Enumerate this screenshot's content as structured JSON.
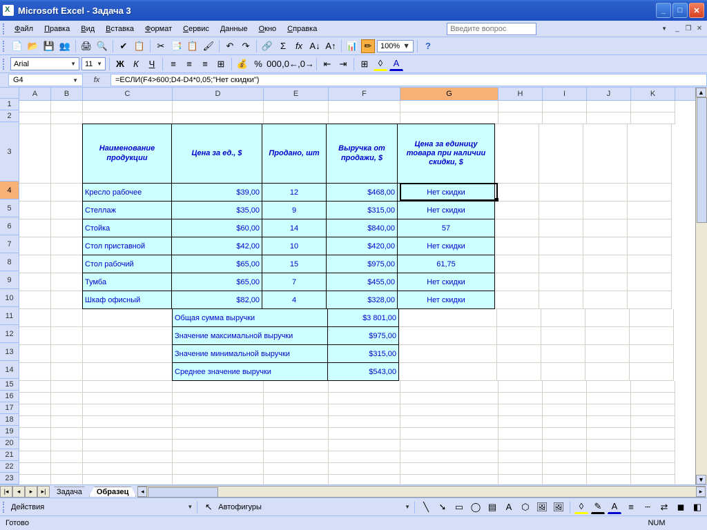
{
  "title": "Microsoft Excel - Задача 3",
  "menus": [
    "Файл",
    "Правка",
    "Вид",
    "Вставка",
    "Формат",
    "Сервис",
    "Данные",
    "Окно",
    "Справка"
  ],
  "question_placeholder": "Введите вопрос",
  "zoom": "100%",
  "font": "Arial",
  "font_size": "11",
  "name_box": "G4",
  "fx": "fx",
  "formula": "=ЕСЛИ(F4>600;D4-D4*0,05;\"Нет скидки\")",
  "columns": [
    {
      "l": "A",
      "w": 46
    },
    {
      "l": "B",
      "w": 46
    },
    {
      "l": "C",
      "w": 130
    },
    {
      "l": "D",
      "w": 132
    },
    {
      "l": "E",
      "w": 94
    },
    {
      "l": "F",
      "w": 104
    },
    {
      "l": "G",
      "w": 142
    },
    {
      "l": "H",
      "w": 64
    },
    {
      "l": "I",
      "w": 64
    },
    {
      "l": "J",
      "w": 64
    },
    {
      "l": "K",
      "w": 64
    }
  ],
  "headers": {
    "c": "Наименование продукции",
    "d": "Цена за ед., $",
    "e": "Продано, шт",
    "f": "Выручка от продажи, $",
    "g": "Цена за единицу товара при наличии скидки, $"
  },
  "rows": [
    {
      "c": "Кресло рабочее",
      "d": "$39,00",
      "e": "12",
      "f": "$468,00",
      "g": "Нет скидки"
    },
    {
      "c": "Стеллаж",
      "d": "$35,00",
      "e": "9",
      "f": "$315,00",
      "g": "Нет скидки"
    },
    {
      "c": "Стойка",
      "d": "$60,00",
      "e": "14",
      "f": "$840,00",
      "g": "57"
    },
    {
      "c": "Стол приставной",
      "d": "$42,00",
      "e": "10",
      "f": "$420,00",
      "g": "Нет скидки"
    },
    {
      "c": "Стол рабочий",
      "d": "$65,00",
      "e": "15",
      "f": "$975,00",
      "g": "61,75"
    },
    {
      "c": "Тумба",
      "d": "$65,00",
      "e": "7",
      "f": "$455,00",
      "g": "Нет скидки"
    },
    {
      "c": "Шкаф офисный",
      "d": "$82,00",
      "e": "4",
      "f": "$328,00",
      "g": "Нет скидки"
    }
  ],
  "summary": [
    {
      "label": "Общая сумма выручки",
      "val": "$3 801,00"
    },
    {
      "label": "Значение максимальной выручки",
      "val": "$975,00"
    },
    {
      "label": "Значение минимальной выручки",
      "val": "$315,00"
    },
    {
      "label": "Среднее значение выручки",
      "val": "$543,00"
    }
  ],
  "sheets": [
    "Задача",
    "Образец"
  ],
  "active_sheet": 1,
  "drawing_label_actions": "Действия",
  "drawing_label_autoshapes": "Автофигуры",
  "status_ready": "Готово",
  "status_num": "NUM"
}
